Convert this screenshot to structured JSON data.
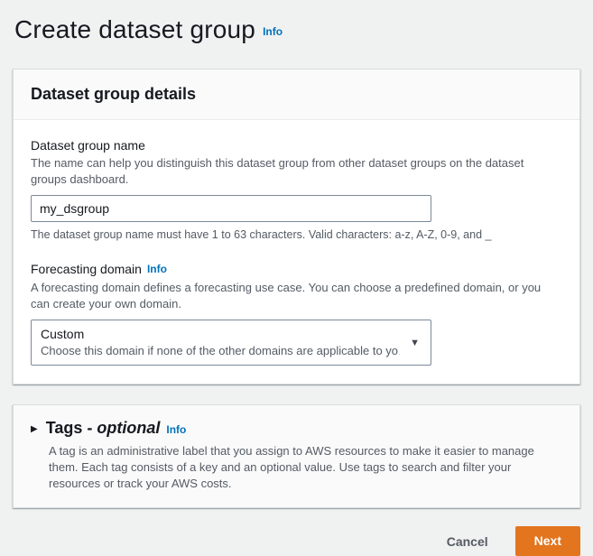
{
  "page": {
    "title": "Create dataset group",
    "info_label": "Info"
  },
  "dataset_group_card": {
    "title": "Dataset group details",
    "name_field": {
      "label": "Dataset group name",
      "description": "The name can help you distinguish this dataset group from other dataset groups on the dataset groups dashboard.",
      "value": "my_dsgroup",
      "constraint": "The dataset group name must have 1 to 63 characters. Valid characters: a-z, A-Z, 0-9, and _"
    },
    "domain_field": {
      "label": "Forecasting domain",
      "info_label": "Info",
      "description": "A forecasting domain defines a forecasting use case. You can choose a predefined domain, or you can create your own domain.",
      "selected_option": "Custom",
      "selected_option_description": "Choose this domain if none of the other domains are applicable to yo…"
    }
  },
  "tags_card": {
    "title_prefix": "Tags - ",
    "title_optional": "optional",
    "info_label": "Info",
    "description": "A tag is an administrative label that you assign to AWS resources to make it easier to manage them. Each tag consists of a key and an optional value. Use tags to search and filter your resources or track your AWS costs."
  },
  "footer": {
    "cancel_label": "Cancel",
    "next_label": "Next"
  },
  "icons": {
    "expand_caret": "▶",
    "dropdown_caret": "▼"
  },
  "colors": {
    "accent_orange": "#e2751e",
    "link_blue": "#0073bb",
    "page_background": "#f0f1f1",
    "card_header_background": "#fafafa"
  }
}
